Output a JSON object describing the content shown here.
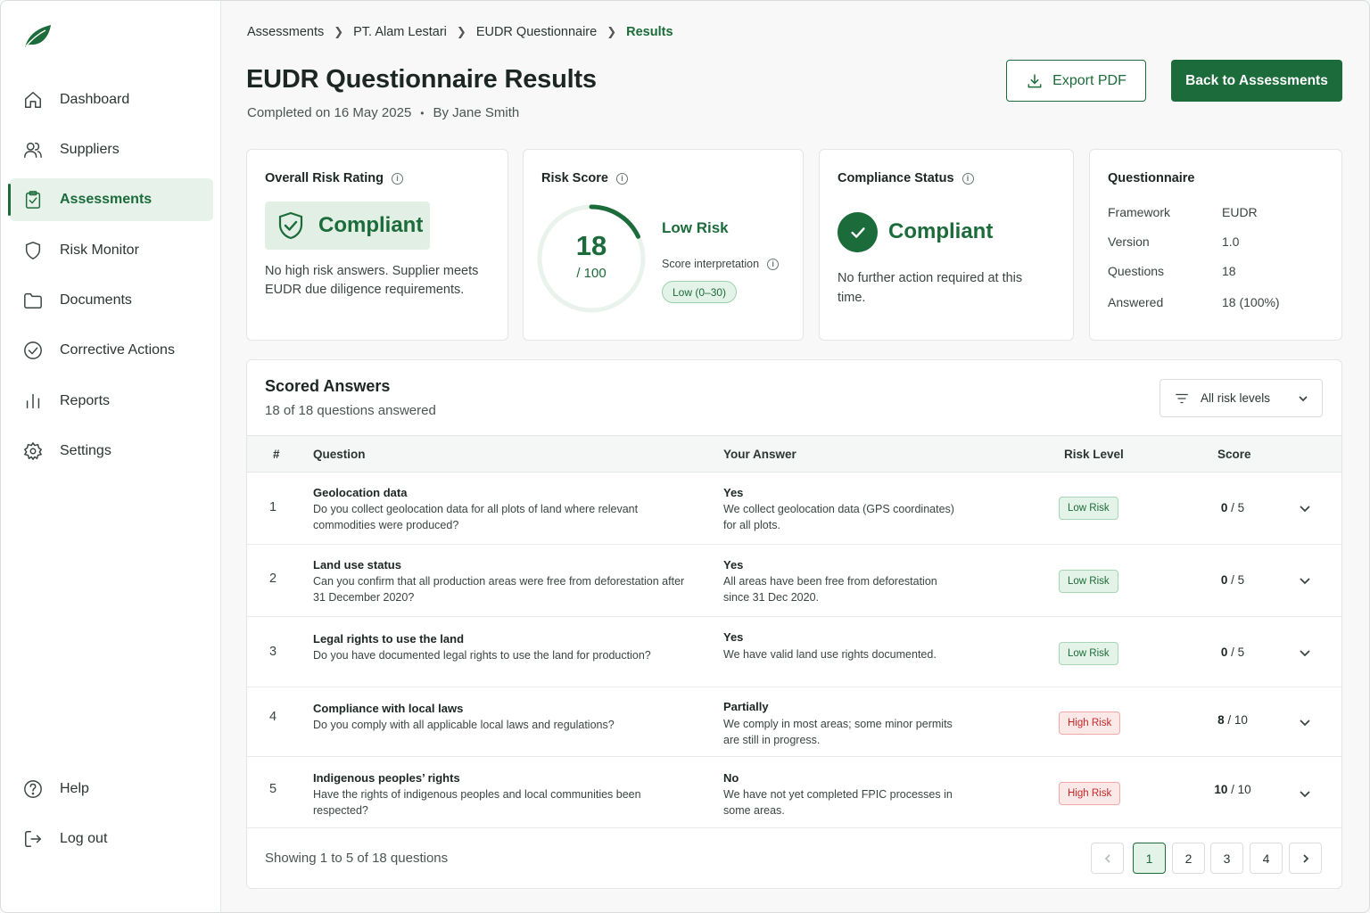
{
  "colors": {
    "brand": "#1c6b3a",
    "brand_light": "#e4f3e8",
    "danger": "#c62828",
    "danger_light": "#fde8e8"
  },
  "logo_icon": "leaf-icon",
  "sidebar": {
    "items": [
      {
        "label": "Dashboard",
        "icon": "home-icon"
      },
      {
        "label": "Suppliers",
        "icon": "users-icon"
      },
      {
        "label": "Assessments",
        "icon": "clipboard-check-icon",
        "active": true
      },
      {
        "label": "Risk Monitor",
        "icon": "shield-icon"
      },
      {
        "label": "Documents",
        "icon": "folder-icon"
      },
      {
        "label": "Corrective Actions",
        "icon": "check-circle-icon"
      },
      {
        "label": "Reports",
        "icon": "bar-chart-icon"
      },
      {
        "label": "Settings",
        "icon": "gear-icon"
      }
    ],
    "bottom": [
      {
        "label": "Help",
        "icon": "help-icon"
      },
      {
        "label": "Log out",
        "icon": "logout-icon"
      }
    ]
  },
  "breadcrumb": [
    "Assessments",
    "PT. Alam Lestari",
    "EUDR Questionnaire",
    "Results"
  ],
  "header": {
    "title": "EUDR Questionnaire Results",
    "completed": "Completed on 16 May 2025",
    "by": "By Jane Smith",
    "export_label": "Export PDF",
    "back_label": "Back to Assessments"
  },
  "overall": {
    "title": "Overall Risk Rating",
    "status": "Compliant",
    "description": "No high risk answers. Supplier meets EUDR due diligence requirements."
  },
  "risk_score": {
    "title": "Risk Score",
    "score": "18",
    "max": "/ 100",
    "score_fraction": 0.18,
    "level": "Low Risk",
    "interpretation_label": "Score interpretation",
    "interpretation_range": "Low (0–30)"
  },
  "compliance": {
    "title": "Compliance Status",
    "status": "Compliant",
    "description": "No further action required at this time."
  },
  "questionnaire": {
    "title": "Questionnaire",
    "rows": [
      {
        "key": "Framework",
        "value": "EUDR"
      },
      {
        "key": "Version",
        "value": "1.0"
      },
      {
        "key": "Questions",
        "value": "18"
      },
      {
        "key": "Answered",
        "value": "18 (100%)"
      }
    ]
  },
  "scored": {
    "title": "Scored Answers",
    "subtitle": "18 of 18 questions answered",
    "filter_label": "All risk levels",
    "columns": [
      "#",
      "Question",
      "Your Answer",
      "Risk Level",
      "Score"
    ],
    "rows": [
      {
        "num": "1",
        "question_title": "Geolocation data",
        "question_desc": "Do you collect geolocation data for all plots of land where relevant commodities were produced?",
        "answer": "Yes",
        "answer_desc": "We collect geolocation data (GPS coordinates) for all plots.",
        "risk": "Low Risk",
        "risk_type": "low",
        "score": "0",
        "score_max": " / 5"
      },
      {
        "num": "2",
        "question_title": "Land use status",
        "question_desc": "Can you confirm that all production areas were free from deforestation after 31 December 2020?",
        "answer": "Yes",
        "answer_desc": "All areas have been free from deforestation since 31 Dec 2020.",
        "risk": "Low Risk",
        "risk_type": "low",
        "score": "0",
        "score_max": " / 5"
      },
      {
        "num": "3",
        "question_title": "Legal rights to use the land",
        "question_desc": "Do you have documented legal rights to use the land for production?",
        "answer": "Yes",
        "answer_desc": "We have valid land use rights documented.",
        "risk": "Low Risk",
        "risk_type": "low",
        "score": "0",
        "score_max": " / 5"
      },
      {
        "num": "4",
        "question_title": "Compliance with local laws",
        "question_desc": "Do you comply with all applicable local laws and regulations?",
        "answer": "Partially",
        "answer_desc": "We comply in most areas; some minor permits are still in progress.",
        "risk": "High Risk",
        "risk_type": "high",
        "score": "8",
        "score_max": " / 10"
      },
      {
        "num": "5",
        "question_title": "Indigenous peoples’ rights",
        "question_desc": "Have the rights of indigenous peoples and local communities been respected?",
        "answer": "No",
        "answer_desc": "We have not yet completed FPIC processes in some areas.",
        "risk": "High Risk",
        "risk_type": "high",
        "score": "10",
        "score_max": " / 10"
      }
    ],
    "showing": "Showing 1 to 5 of 18 questions",
    "pages": [
      "1",
      "2",
      "3",
      "4"
    ],
    "current_page": "1"
  }
}
